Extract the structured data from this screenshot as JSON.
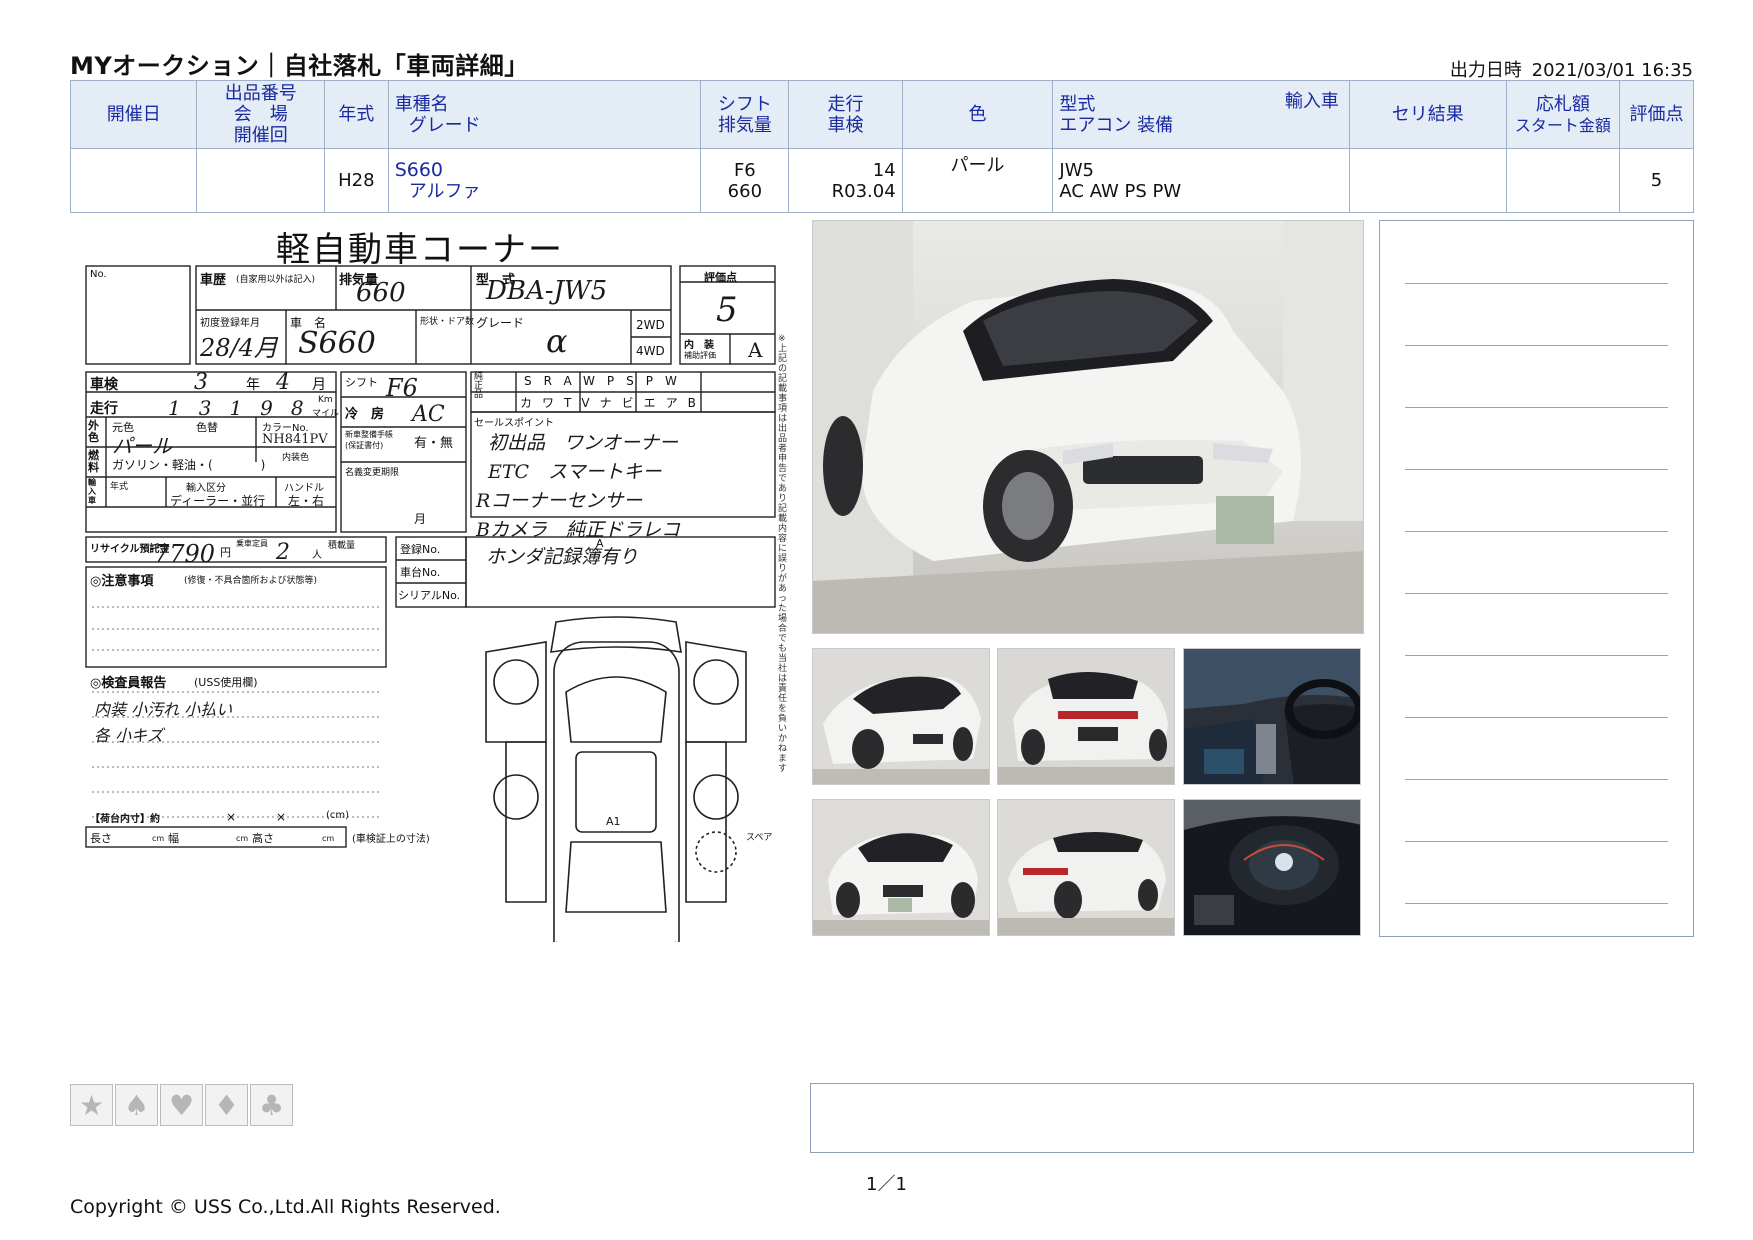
{
  "header": {
    "title": "MYオークション｜自社落札「車両詳細」",
    "output_label": "出力日時",
    "output_datetime": "2021/03/01 16:35"
  },
  "table": {
    "headers": {
      "date": "開催日",
      "lot_no": "出品番号",
      "venue": "会　場",
      "session": "開催回",
      "year": "年式",
      "car_name": "車種名",
      "grade": "グレード",
      "shift": "シフト",
      "displacement": "排気量",
      "mileage": "走行",
      "inspection": "車検",
      "color": "色",
      "model": "型式",
      "import": "輸入車",
      "aircon_equip": "エアコン 装備",
      "result": "セリ結果",
      "bid_amount": "応札額",
      "start_amount": "スタート金額",
      "score": "評価点"
    },
    "row": {
      "date": "",
      "lot": "",
      "year": "H28",
      "car_name": "S660",
      "grade": "アルファ",
      "shift": "F6",
      "displacement": "660",
      "mileage": "14",
      "inspection": "R03.04",
      "color": "パール",
      "model": "JW5",
      "equipment": "AC AW PS PW",
      "result": "",
      "bid": "",
      "score": "5"
    }
  },
  "sheet": {
    "title": "軽自動車コーナー",
    "labels": {
      "no": "No.",
      "history": "車歴",
      "history_note": "(自家用以外は記入)",
      "displacement": "排気量",
      "model": "型　式",
      "score": "評価点",
      "first_reg": "初度登録年月",
      "car_name": "車　名",
      "shape": "形状・ドア数",
      "grade": "グレード",
      "drive_2wd": "2WD",
      "drive_4wd": "4WD",
      "interior": "内　装",
      "interior_sub": "補助評価",
      "inspection": "車検",
      "year_unit": "年",
      "month_unit": "月",
      "mileage": "走行",
      "km": "Km",
      "mile": "マイル",
      "shift": "シフト",
      "aircon": "冷　房",
      "equipment": "純正品",
      "eq_items": [
        "SR",
        "AW",
        "PS",
        "PW",
        "カワ",
        "TV",
        "ナビ",
        "エアB"
      ],
      "outer_color": "外色",
      "orig_color": "元色",
      "color_change": "色替",
      "color_no": "カラーNo.",
      "interior_color": "内装色",
      "fuel": "燃料",
      "fuel_options": "ガソリン・軽油・(　　　　)",
      "import": "輸入車",
      "import_year": "年式",
      "import_type": "輸入区分",
      "import_options": "ディーラー・並行",
      "handle": "ハンドル",
      "handle_options": "左・右",
      "sales_point": "セールスポイント",
      "maintenance": "新車整備手帳",
      "maintenance_sub": "(保証書付)",
      "maintenance_opt": "有・無",
      "name_change": "名義変更期限",
      "recycle": "リサイクル預託金",
      "yen": "円",
      "capacity": "乗車定員",
      "capacity_unit": "人",
      "load": "積載量",
      "reg_no": "登録No.",
      "chassis_no": "車台No.",
      "serial_no": "シリアルNo.",
      "caution": "◎注意事項",
      "caution_sub": "(修復・不具合箇所および状態等)",
      "inspector": "◎検査員報告",
      "inspector_sub": "(USS使用欄)",
      "cargo": "【荷台内寸】約",
      "cargo_x": "×",
      "cargo_cm": "(cm)",
      "length": "長さ",
      "width": "幅",
      "height": "高さ",
      "cm": "cm",
      "cert_note": "(車検証上の寸法)",
      "spare": "スペア",
      "side_note": "※上記の記載事項は出品者申告であり記載内容に誤りがあった場合でも当社は責任を負いかねます",
      "mark_a": "A",
      "mark_a1": "A1"
    },
    "hand": {
      "displacement": "660",
      "model": "DBA-JW5",
      "score": "5",
      "first_reg": "28/4月",
      "car_name": "S660",
      "grade": "α",
      "interior": "A",
      "inspection_year": "3",
      "inspection_month": "4",
      "mileage": "13198",
      "shift": "F6",
      "aircon": "AC",
      "color": "パール",
      "color_no": "NH841PV",
      "recycle": "7790",
      "capacity": "2",
      "sales_points": [
        "初出品　ワンオーナー",
        "ETC　スマートキー",
        "Rコーナーセンサー",
        "Bカメラ　純正ドラレコ",
        "ホンダ記録簿有り"
      ],
      "inspector_notes": [
        "内装 小汚れ 小払い",
        "各 小キズ"
      ],
      "maintenance_choice": "有"
    }
  },
  "photos": {
    "main": "car-photo-main",
    "thumbs": [
      "front-left",
      "rear",
      "interior",
      "front",
      "rear-right",
      "meter"
    ]
  },
  "icons": [
    "star-icon",
    "spade-icon",
    "heart-icon",
    "diamond-icon",
    "club-icon"
  ],
  "icon_glyphs": [
    "★",
    "♠",
    "♥",
    "♦",
    "♣"
  ],
  "footer": {
    "page": "1／1",
    "copyright": "Copyright © USS Co.,Ltd.All Rights Reserved."
  }
}
